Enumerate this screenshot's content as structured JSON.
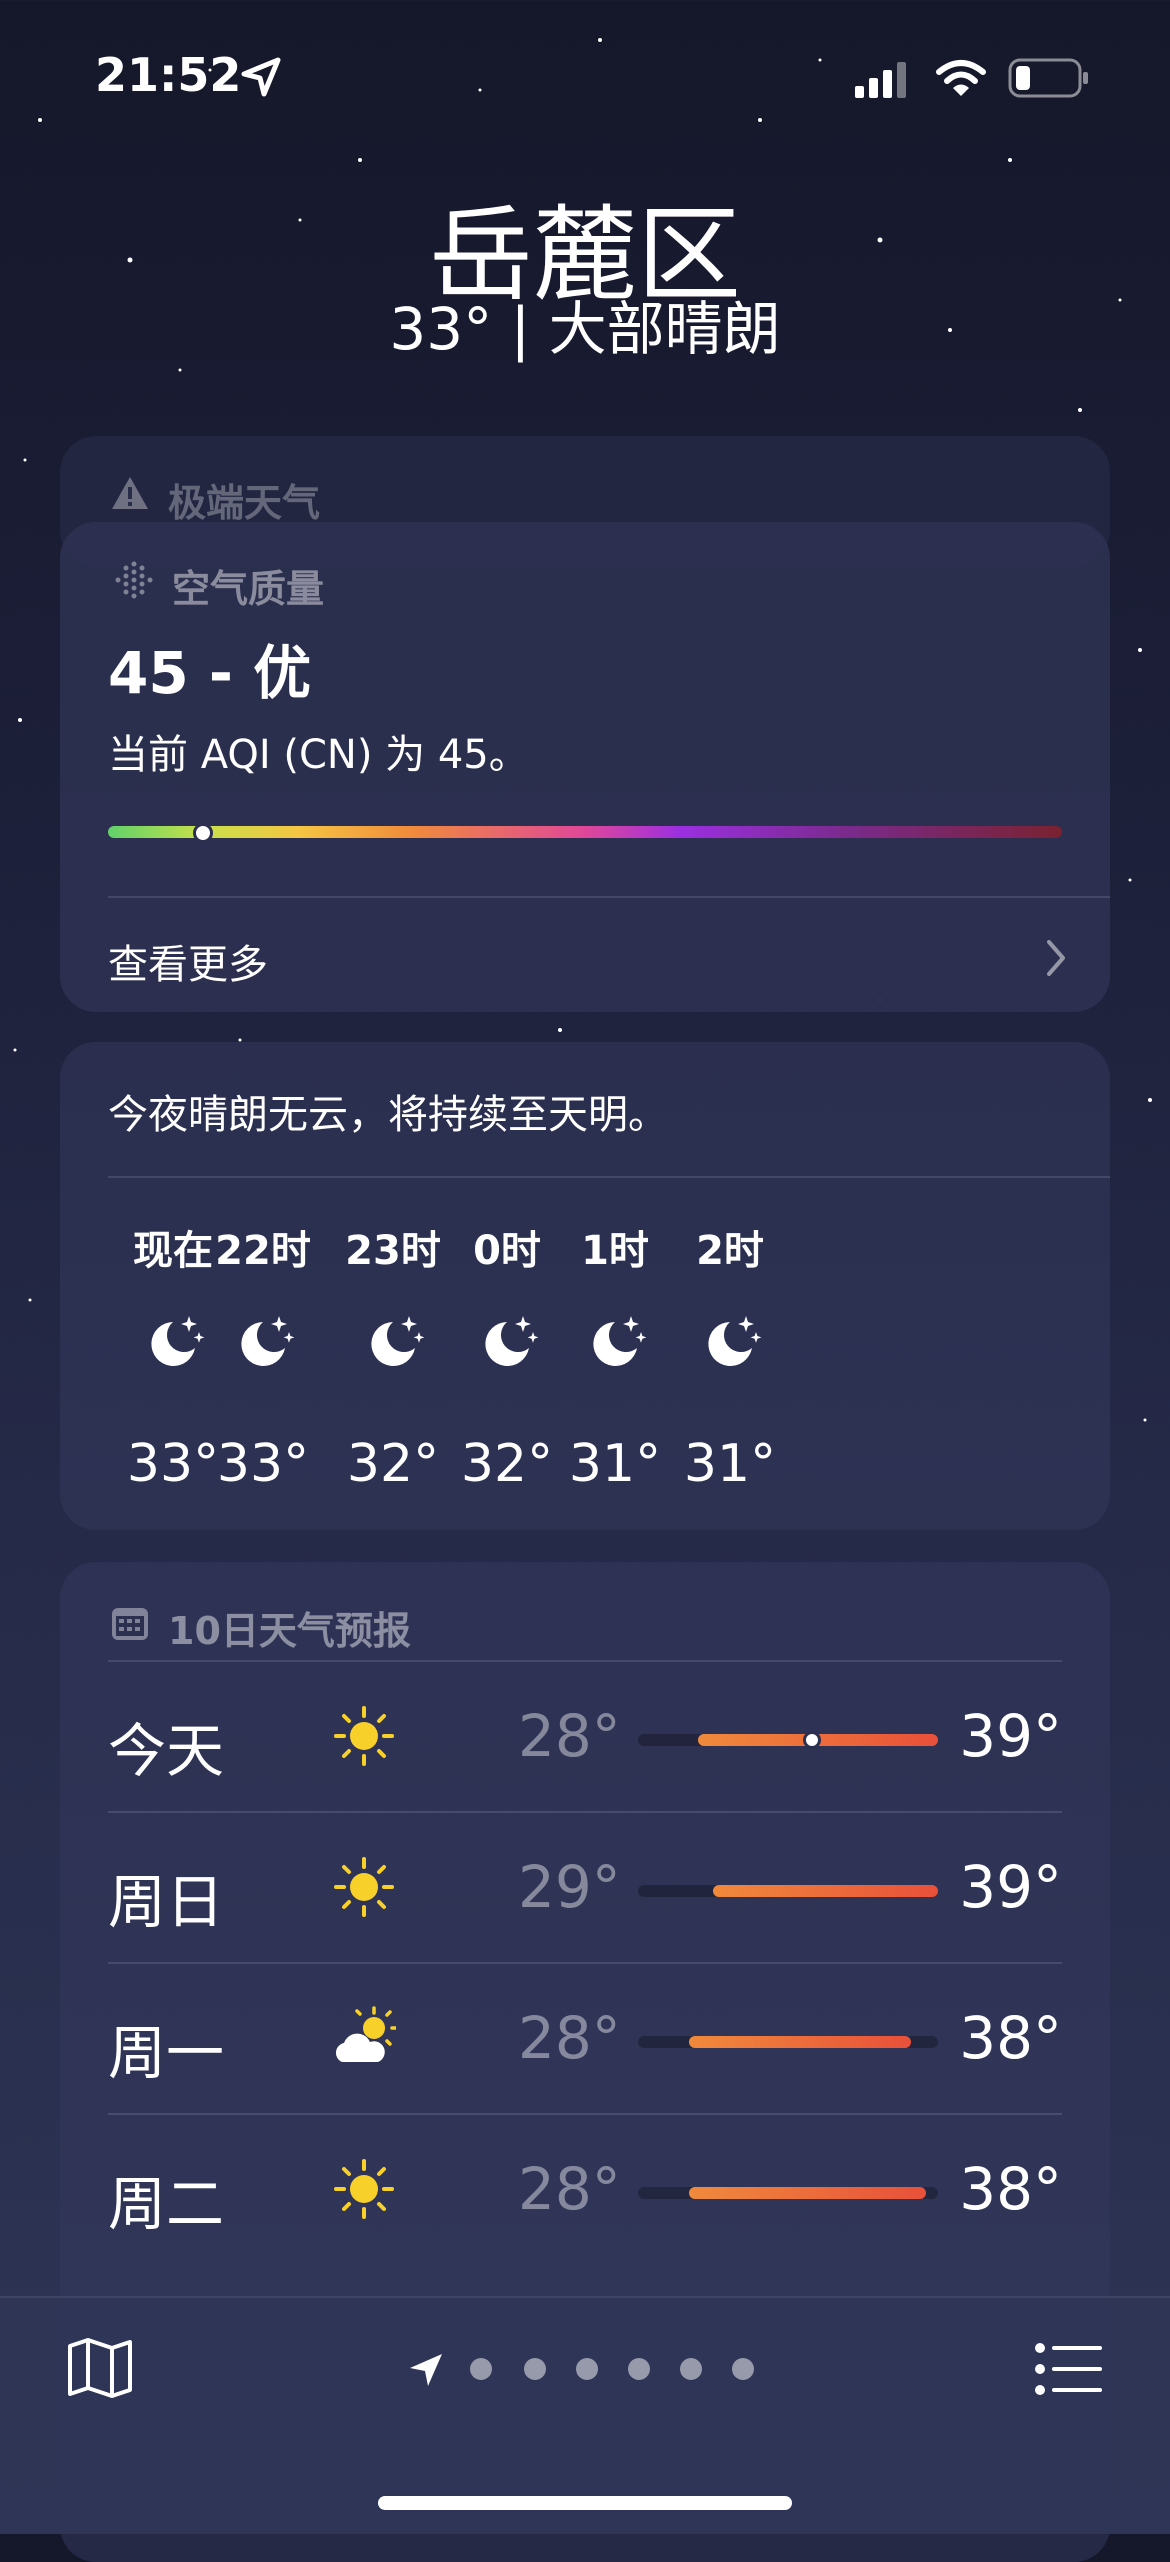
{
  "status": {
    "time": "21:52"
  },
  "location": {
    "name": "岳麓区",
    "summary": "33° | 大部晴朗"
  },
  "extreme": {
    "title": "极端天气"
  },
  "aqi": {
    "title": "空气质量",
    "value": "45 - 优",
    "desc": "当前 AQI (CN) 为 45。",
    "level_fraction": 0.1,
    "more": "查看更多"
  },
  "hourly": {
    "summary": "今夜晴朗无云，将持续至天明。",
    "items": [
      {
        "label": "现在",
        "temp": "33°",
        "icon": "moon-stars-icon"
      },
      {
        "label": "22时",
        "temp": "33°",
        "icon": "moon-stars-icon"
      },
      {
        "label": "23时",
        "temp": "32°",
        "icon": "moon-stars-icon"
      },
      {
        "label": "0时",
        "temp": "32°",
        "icon": "moon-stars-icon"
      },
      {
        "label": "1时",
        "temp": "31°",
        "icon": "moon-stars-icon"
      },
      {
        "label": "2时",
        "temp": "31°",
        "icon": "moon-stars-icon"
      }
    ]
  },
  "forecast": {
    "title": "10日天气预报",
    "days": [
      {
        "day": "今天",
        "icon": "sun-icon",
        "lo": "28°",
        "hi": "39°",
        "range_start": 0.2,
        "range_end": 1.0,
        "current": 0.58
      },
      {
        "day": "周日",
        "icon": "sun-icon",
        "lo": "29°",
        "hi": "39°",
        "range_start": 0.25,
        "range_end": 1.0
      },
      {
        "day": "周一",
        "icon": "cloud-sun-icon",
        "lo": "28°",
        "hi": "38°",
        "range_start": 0.17,
        "range_end": 0.91
      },
      {
        "day": "周二",
        "icon": "sun-icon",
        "lo": "28°",
        "hi": "38°",
        "range_start": 0.17,
        "range_end": 0.96
      }
    ]
  },
  "colors": {
    "accent": "#f08a3c",
    "hot": "#e8503a",
    "sun": "#f8d02a"
  }
}
